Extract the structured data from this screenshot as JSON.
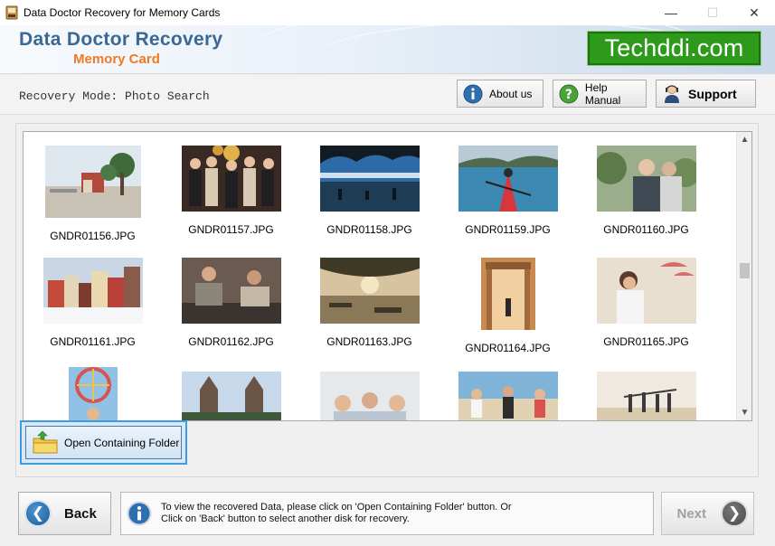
{
  "window": {
    "title": "Data Doctor Recovery for Memory Cards",
    "minimize_glyph": "—",
    "maximize_glyph": "☐",
    "close_glyph": "✕"
  },
  "header": {
    "brand_title": "Data Doctor Recovery",
    "brand_subtitle": "Memory Card",
    "watermark": "Techddi.com",
    "brand_color": "#3a6896",
    "accent_color": "#ee7a26",
    "watermark_color": "#2e9a1c"
  },
  "mode": {
    "text": "Recovery Mode: Photo Search"
  },
  "top_buttons": {
    "about": {
      "label": "About us",
      "icon": "info-icon"
    },
    "help": {
      "label": "Help Manual",
      "icon": "help-icon"
    },
    "support": {
      "label": "Support",
      "icon": "support-person-icon"
    }
  },
  "gallery": {
    "items": [
      {
        "name": "GNDR01156.JPG"
      },
      {
        "name": "GNDR01157.JPG"
      },
      {
        "name": "GNDR01158.JPG"
      },
      {
        "name": "GNDR01159.JPG"
      },
      {
        "name": "GNDR01160.JPG"
      },
      {
        "name": "GNDR01161.JPG"
      },
      {
        "name": "GNDR01162.JPG"
      },
      {
        "name": "GNDR01163.JPG"
      },
      {
        "name": "GNDR01164.JPG"
      },
      {
        "name": "GNDR01165.JPG"
      },
      {
        "name": ""
      },
      {
        "name": ""
      },
      {
        "name": ""
      },
      {
        "name": ""
      },
      {
        "name": ""
      }
    ],
    "scroll_up_glyph": "▲",
    "scroll_down_glyph": "▼"
  },
  "open_folder": {
    "label": "Open Containing Folder",
    "icon": "folder-up-icon"
  },
  "bottom": {
    "back_label": "Back",
    "back_glyph": "❮",
    "info_line1": "To view the recovered Data, please click on 'Open Containing Folder' button. Or",
    "info_line2": "Click on 'Back' button to select another disk for recovery.",
    "next_label": "Next",
    "next_glyph": "❯"
  }
}
